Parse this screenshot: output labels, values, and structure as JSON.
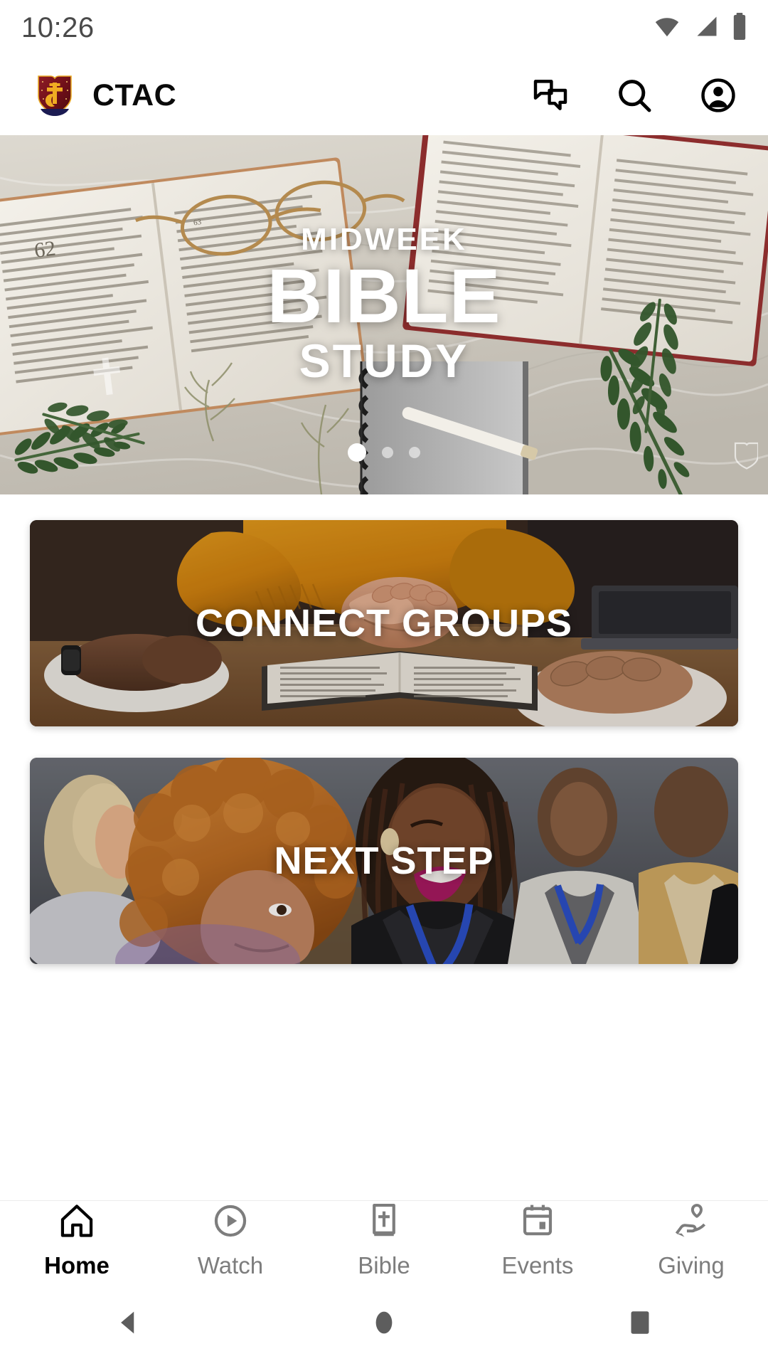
{
  "status_bar": {
    "time": "10:26",
    "icons": [
      "wifi-icon",
      "cellular-signal-icon",
      "battery-icon"
    ]
  },
  "app_bar": {
    "logo": "ctac-shield-logo",
    "title": "CTAC",
    "actions": [
      {
        "name": "chat-icon",
        "label": "Chat"
      },
      {
        "name": "search-icon",
        "label": "Search"
      },
      {
        "name": "account-icon",
        "label": "Account"
      }
    ]
  },
  "hero": {
    "kicker": "MIDWEEK",
    "main": "BIBLE",
    "sub": "STUDY",
    "slide_count": 3,
    "active_slide": 1,
    "watermark": "shield-watermark-icon"
  },
  "cards": [
    {
      "label": "CONNECT GROUPS",
      "name": "card-connect-groups"
    },
    {
      "label": "NEXT STEP",
      "name": "card-next-step"
    }
  ],
  "bottom_nav": {
    "active": "Home",
    "items": [
      {
        "label": "Home",
        "icon": "home-icon",
        "name": "nav-item-home"
      },
      {
        "label": "Watch",
        "icon": "play-circle-icon",
        "name": "nav-item-watch"
      },
      {
        "label": "Bible",
        "icon": "bible-book-icon",
        "name": "nav-item-bible"
      },
      {
        "label": "Events",
        "icon": "calendar-icon",
        "name": "nav-item-events"
      },
      {
        "label": "Giving",
        "icon": "hand-heart-icon",
        "name": "nav-item-giving"
      }
    ]
  },
  "system_nav": {
    "back": "back-triangle-icon",
    "home": "home-circle-icon",
    "recents": "recents-square-icon"
  },
  "colors": {
    "brand_maroon": "#7a1420",
    "brand_gold": "#e8a825",
    "accent_active": "#000000",
    "nav_inactive": "#7d7d7d",
    "background": "#ffffff"
  }
}
